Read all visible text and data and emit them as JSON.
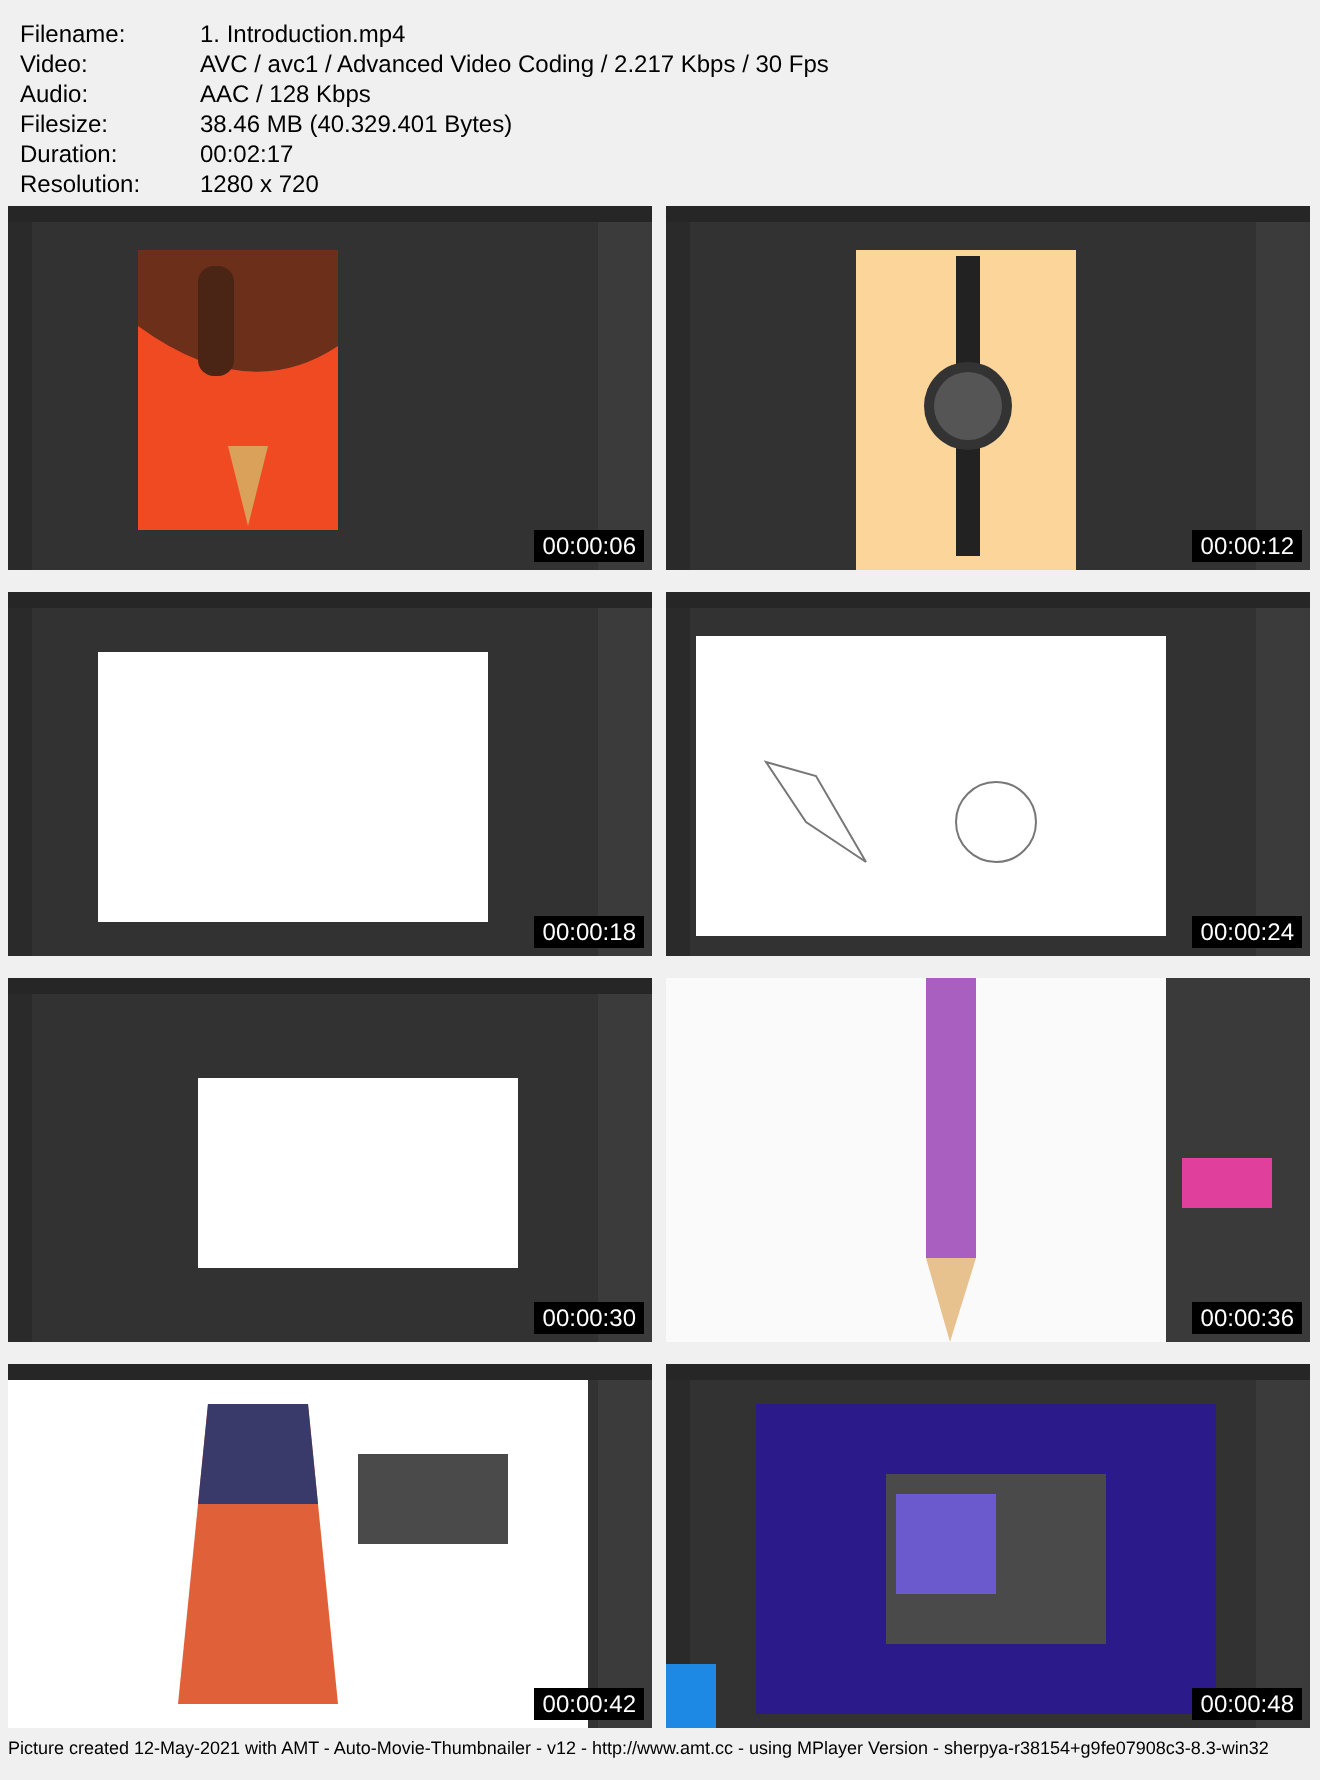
{
  "info": [
    {
      "label": "Filename:",
      "value": "1. Introduction.mp4"
    },
    {
      "label": "Video:",
      "value": "AVC / avc1 / Advanced Video Coding / 2.217 Kbps / 30 Fps"
    },
    {
      "label": "Audio:",
      "value": "AAC / 128 Kbps"
    },
    {
      "label": "Filesize:",
      "value": "38.46 MB (40.329.401 Bytes)"
    },
    {
      "label": "Duration:",
      "value": "00:02:17"
    },
    {
      "label": "Resolution:",
      "value": "1280 x 720"
    }
  ],
  "thumbnails": [
    {
      "kind": "picture",
      "time": "00:00:06"
    },
    {
      "kind": "picture",
      "time": "00:00:12"
    },
    {
      "kind": "picture",
      "time": "00:00:18"
    },
    {
      "kind": "picture",
      "time": "00:00:24"
    },
    {
      "kind": "picture",
      "time": "00:00:30"
    },
    {
      "kind": "picture",
      "time": "00:00:36"
    },
    {
      "kind": "picture",
      "time": "00:00:42"
    },
    {
      "kind": "picture",
      "time": "00:00:48"
    }
  ],
  "footer": "Picture created 12-May-2021 with AMT - Auto-Movie-Thumbnailer - v12 - http://www.amt.cc - using MPlayer Version - sherpya-r38154+g9fe07908c3-8.3-win32"
}
